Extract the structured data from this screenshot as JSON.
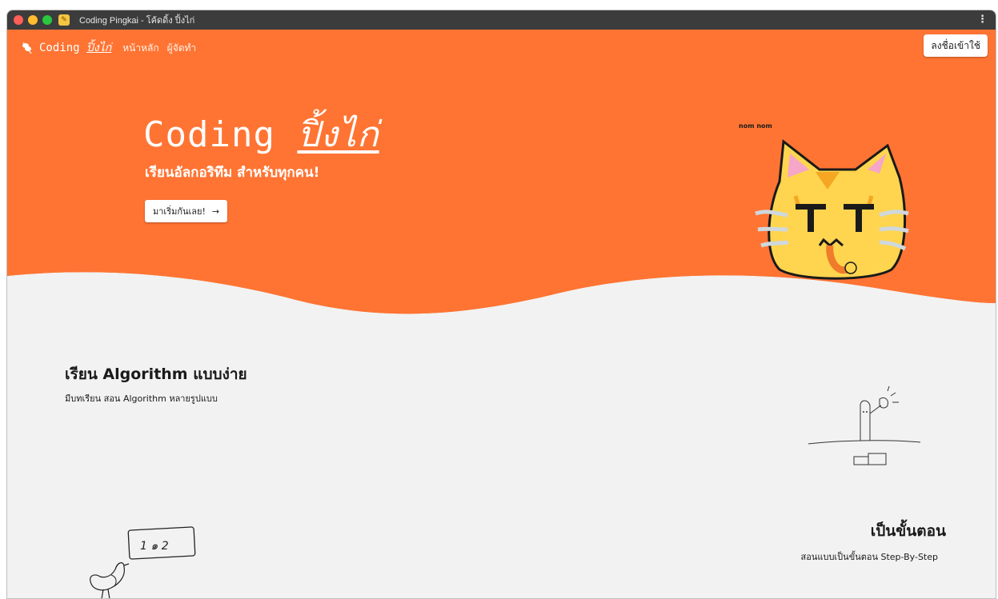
{
  "window": {
    "title": "Coding Pingkai - โค้ดดิ้ง ปิ้งไก่",
    "favicon": "chicken-favicon-icon",
    "menu_icon": "kebab-menu-icon"
  },
  "navbar": {
    "logo_icon": "skewer-logo-icon",
    "brand_main": "Coding ",
    "brand_accent": "ปิ้งไก่",
    "links": [
      "หน้าหลัก",
      "ผู้จัดทำ"
    ],
    "login_label": "ลงชื่อเข้าใช้"
  },
  "hero": {
    "title_main": "Coding ",
    "title_accent": "ปิ้งไก่",
    "subtitle": "เรียนอัลกอริทึม สำหรับทุกคน!",
    "cta_label": "มาเริ่มกันเลย!",
    "cta_icon": "arrow-right-icon",
    "cat_label": "nom nom",
    "background_color": "#ff7433"
  },
  "sections": [
    {
      "title": "เรียน Algorithm แบบง่าย",
      "text": "มีบทเรียน สอน Algorithm หลายรูปแบบ"
    },
    {
      "title": "เป็นขั้นตอน",
      "text": "สอนแบบเป็นขั้นตอน Step-By-Step"
    }
  ],
  "sketch_chicken_board": "1 ๑ 2"
}
